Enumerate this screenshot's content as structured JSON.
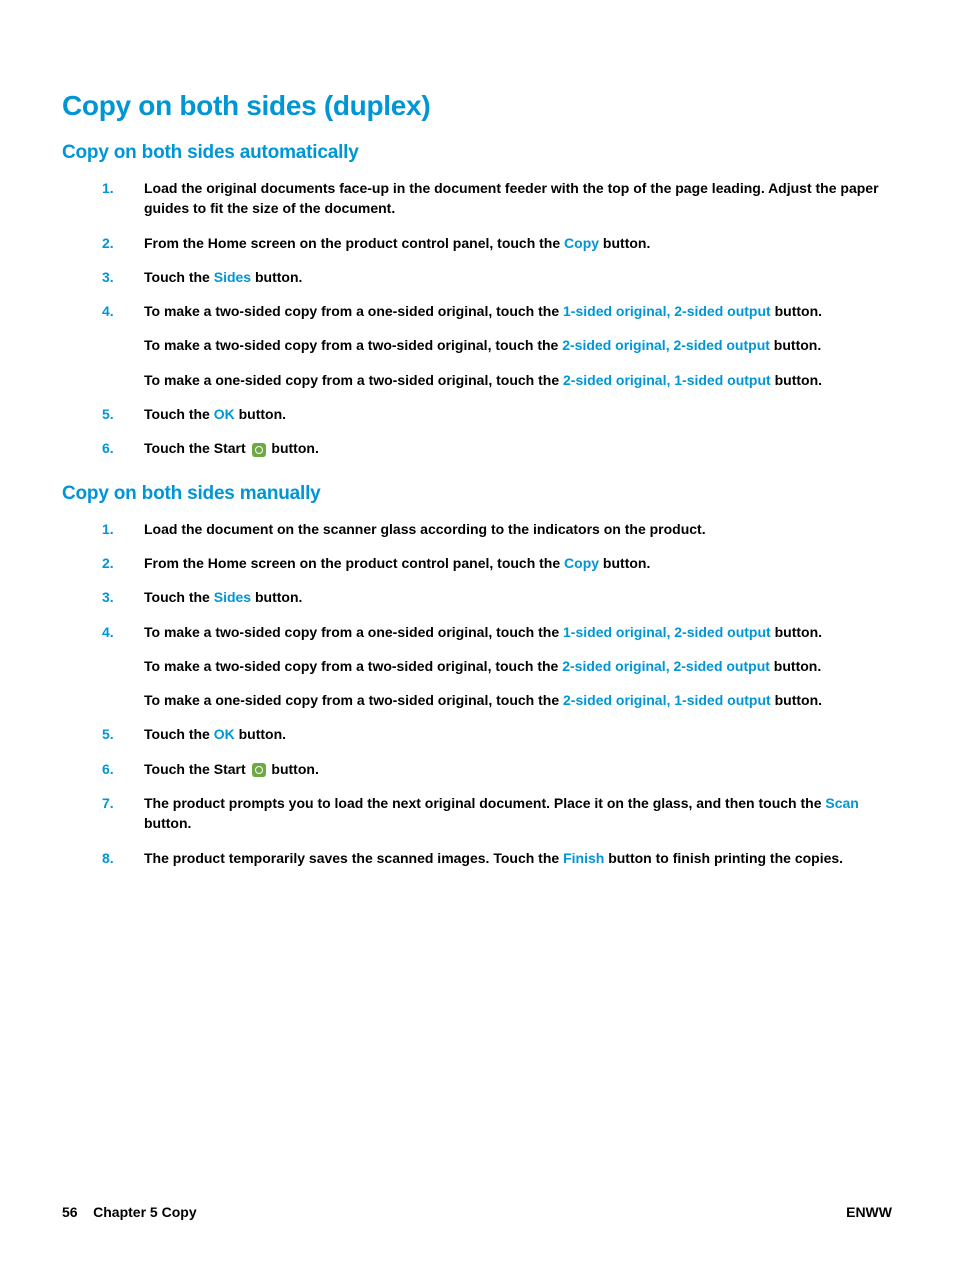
{
  "main_heading": "Copy on both sides (duplex)",
  "section_auto": {
    "heading": "Copy on both sides automatically",
    "steps": [
      {
        "num": "1.",
        "text": "Load the original documents face-up in the document feeder with the top of the page leading. Adjust the paper guides to fit the size of the document."
      },
      {
        "num": "2.",
        "pre": "From the Home screen on the product control panel, touch the ",
        "ui": "Copy",
        "post": " button."
      },
      {
        "num": "3.",
        "pre": "Touch the ",
        "ui": "Sides",
        "post": " button."
      },
      {
        "num": "4.",
        "a_pre": "To make a two-sided copy from a one-sided original, touch the ",
        "a_ui": "1-sided original, 2-sided output",
        "a_post": " button.",
        "b_pre": "To make a two-sided copy from a two-sided original, touch the ",
        "b_ui": "2-sided original, 2-sided output",
        "b_post": " button.",
        "c_pre": "To make a one-sided copy from a two-sided original, touch the ",
        "c_ui": "2-sided original, 1-sided output",
        "c_post": " button."
      },
      {
        "num": "5.",
        "pre": "Touch the ",
        "ui": "OK",
        "post": " button."
      },
      {
        "num": "6.",
        "pre": "Touch the Start ",
        "post": " button."
      }
    ]
  },
  "section_manual": {
    "heading": "Copy on both sides manually",
    "steps": [
      {
        "num": "1.",
        "text": "Load the document on the scanner glass according to the indicators on the product."
      },
      {
        "num": "2.",
        "pre": "From the Home screen on the product control panel, touch the ",
        "ui": "Copy",
        "post": " button."
      },
      {
        "num": "3.",
        "pre": "Touch the ",
        "ui": "Sides",
        "post": " button."
      },
      {
        "num": "4.",
        "a_pre": "To make a two-sided copy from a one-sided original, touch the ",
        "a_ui": "1-sided original, 2-sided output",
        "a_post": " button.",
        "b_pre": "To make a two-sided copy from a two-sided original, touch the ",
        "b_ui": "2-sided original, 2-sided output",
        "b_post": " button.",
        "c_pre": "To make a one-sided copy from a two-sided original, touch the ",
        "c_ui": "2-sided original, 1-sided output",
        "c_post": " button."
      },
      {
        "num": "5.",
        "pre": "Touch the ",
        "ui": "OK",
        "post": " button."
      },
      {
        "num": "6.",
        "pre": "Touch the Start ",
        "post": " button."
      },
      {
        "num": "7.",
        "pre": "The product prompts you to load the next original document. Place it on the glass, and then touch the ",
        "ui": "Scan",
        "post": " button."
      },
      {
        "num": "8.",
        "pre": "The product temporarily saves the scanned images. Touch the ",
        "ui": "Finish",
        "post": " button to finish printing the copies."
      }
    ]
  },
  "footer": {
    "page": "56",
    "chapter": "Chapter 5   Copy",
    "right": "ENWW"
  }
}
